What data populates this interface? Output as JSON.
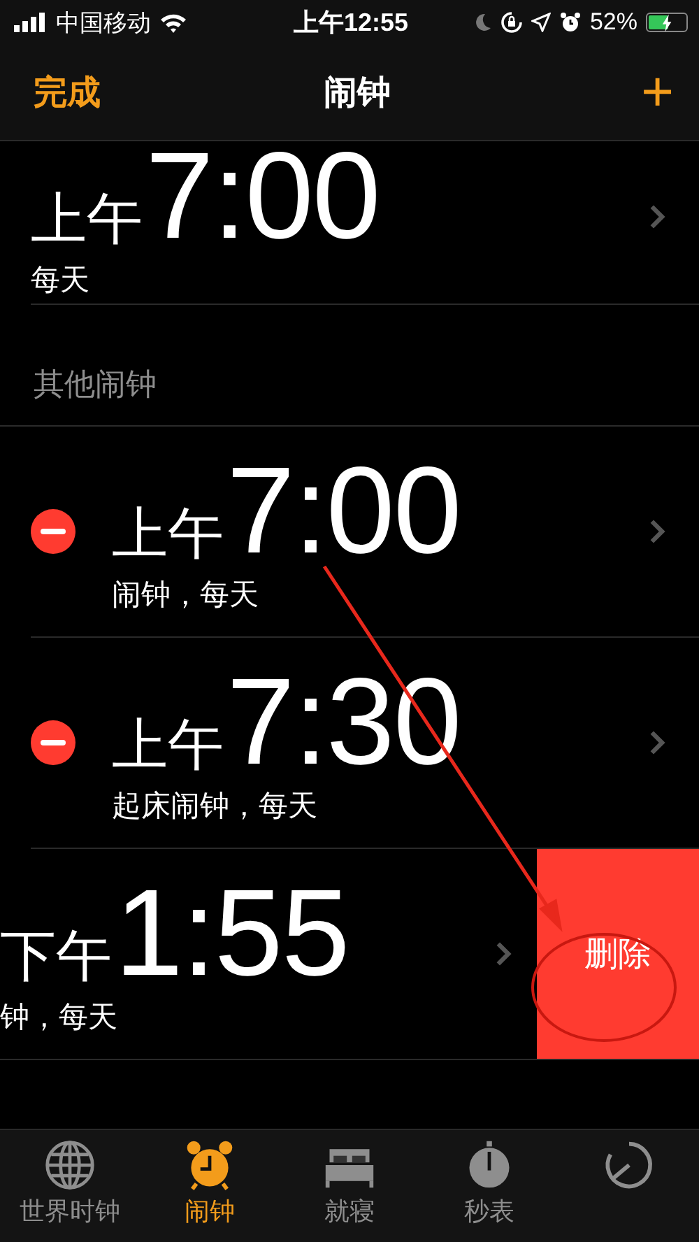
{
  "status_bar": {
    "carrier": "中国移动",
    "time": "上午12:55",
    "battery": "52%"
  },
  "nav": {
    "left": "完成",
    "title": "闹钟",
    "right": "+"
  },
  "alarms": [
    {
      "kind": "plain",
      "period": "上午",
      "time": "7:00",
      "label": "每天"
    }
  ],
  "section": {
    "title": "其他闹钟"
  },
  "other_alarms": [
    {
      "kind": "editing",
      "period": "上午",
      "time": "7:00",
      "label": "闹钟，每天"
    },
    {
      "kind": "editing",
      "period": "上午",
      "time": "7:30",
      "label": "起床闹钟，每天"
    },
    {
      "kind": "swiped",
      "period": "下午",
      "time": "1:55",
      "label": "钟，每天",
      "action": "删除"
    }
  ],
  "tabs": [
    {
      "kind": "globe",
      "label": "世界时钟",
      "selected": false
    },
    {
      "kind": "alarm",
      "label": "闹钟",
      "selected": true
    },
    {
      "kind": "bed",
      "label": "就寝",
      "selected": false
    },
    {
      "kind": "stopwatch",
      "label": "秒表",
      "selected": false
    },
    {
      "kind": "timer",
      "selected": false
    }
  ]
}
